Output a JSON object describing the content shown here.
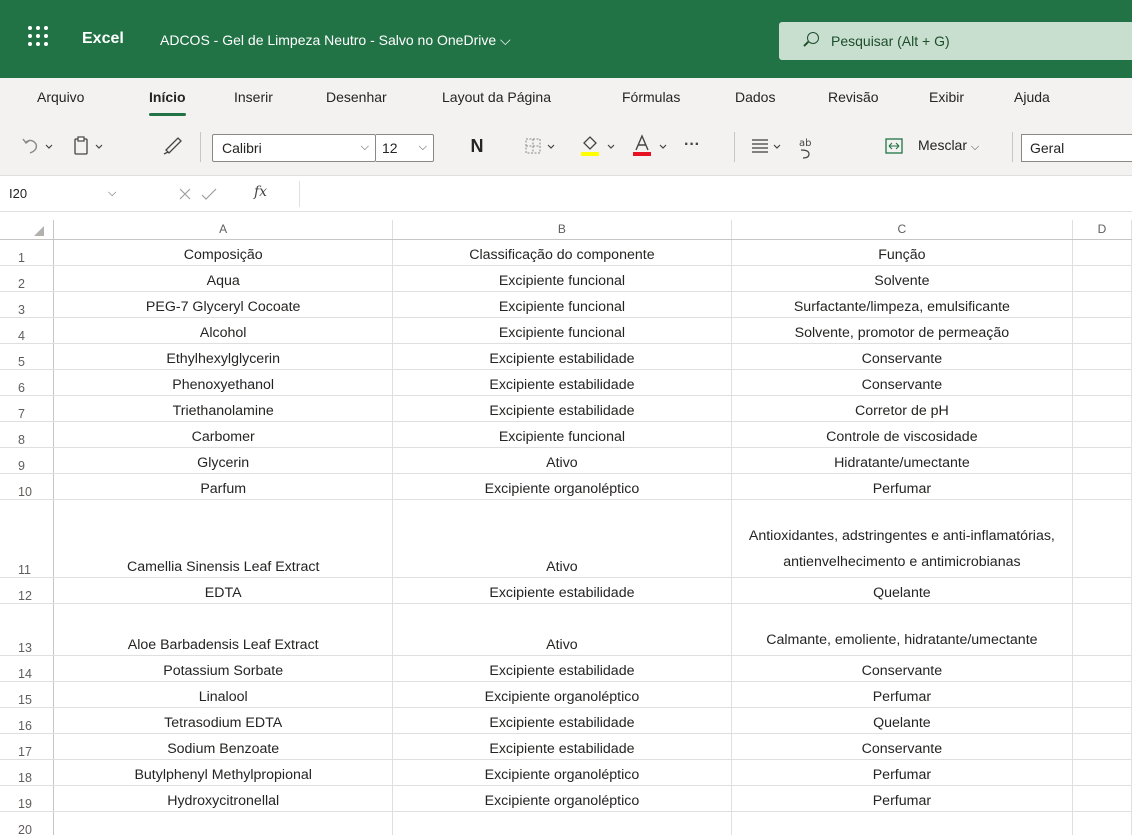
{
  "app": {
    "name": "Excel",
    "doc_title": "ADCOS - Gel de Limpeza Neutro  -  Salvo no OneDrive ⌵",
    "search_placeholder": "Pesquisar (Alt + G)",
    "accent": "#217346"
  },
  "tabs": [
    "Arquivo",
    "Início",
    "Inserir",
    "Desenhar",
    "Layout da Página",
    "Fórmulas",
    "Dados",
    "Revisão",
    "Exibir",
    "Ajuda"
  ],
  "active_tab": "Início",
  "toolbar": {
    "font": "Calibri",
    "size": "12",
    "bold_label": "N",
    "more": "···",
    "merge_label": "Mesclar",
    "number_format": "Geral",
    "undo_icon": "undo-icon",
    "paste_icon": "clipboard-icon",
    "format_painter_icon": "brush-icon",
    "borders_icon": "borders-icon",
    "fill_icon": "fill-color-icon",
    "font_color_icon": "font-color-icon",
    "align_icon": "align-icon",
    "wrap_icon": "wrap-text-icon",
    "merge_icon": "merge-icon",
    "fill_color": "#ffff00",
    "font_color": "#e81123"
  },
  "formula_bar": {
    "cell_ref": "I20",
    "fx": "fx",
    "value": ""
  },
  "grid": {
    "columns": [
      "A",
      "B",
      "C",
      "D"
    ],
    "rows": [
      {
        "n": "1",
        "a": "Composição",
        "b": "Classificação do componente",
        "c": "Função"
      },
      {
        "n": "2",
        "a": "Aqua",
        "b": "Excipiente funcional",
        "c": "Solvente"
      },
      {
        "n": "3",
        "a": "PEG-7 Glyceryl Cocoate",
        "b": "Excipiente funcional",
        "c": "Surfactante/limpeza, emulsificante"
      },
      {
        "n": "4",
        "a": "Alcohol",
        "b": "Excipiente funcional",
        "c": "Solvente, promotor de permeação"
      },
      {
        "n": "5",
        "a": "Ethylhexylglycerin",
        "b": "Excipiente estabilidade",
        "c": "Conservante"
      },
      {
        "n": "6",
        "a": "Phenoxyethanol",
        "b": "Excipiente estabilidade",
        "c": "Conservante"
      },
      {
        "n": "7",
        "a": "Triethanolamine",
        "b": "Excipiente estabilidade",
        "c": "Corretor de pH"
      },
      {
        "n": "8",
        "a": "Carbomer",
        "b": "Excipiente funcional",
        "c": "Controle de viscosidade"
      },
      {
        "n": "9",
        "a": "Glycerin",
        "b": "Ativo",
        "c": "Hidratante/umectante"
      },
      {
        "n": "10",
        "a": "Parfum",
        "b": "Excipiente organoléptico",
        "c": "Perfumar"
      },
      {
        "n": "11",
        "a": "Camellia Sinensis Leaf Extract",
        "b": "Ativo",
        "c": "Antioxidantes, adstringentes e anti-inflamatórias, antienvelhecimento e antimicrobianas"
      },
      {
        "n": "12",
        "a": "EDTA",
        "b": "Excipiente estabilidade",
        "c": "Quelante"
      },
      {
        "n": "13",
        "a": "Aloe Barbadensis Leaf Extract",
        "b": "Ativo",
        "c": "Calmante, emoliente, hidratante/umectante"
      },
      {
        "n": "14",
        "a": "Potassium Sorbate",
        "b": "Excipiente estabilidade",
        "c": "Conservante"
      },
      {
        "n": "15",
        "a": "Linalool",
        "b": "Excipiente organoléptico",
        "c": "Perfumar"
      },
      {
        "n": "16",
        "a": "Tetrasodium EDTA",
        "b": "Excipiente estabilidade",
        "c": "Quelante"
      },
      {
        "n": "17",
        "a": "Sodium Benzoate",
        "b": "Excipiente estabilidade",
        "c": "Conservante"
      },
      {
        "n": "18",
        "a": "Butylphenyl Methylpropional",
        "b": "Excipiente organoléptico",
        "c": "Perfumar"
      },
      {
        "n": "19",
        "a": "Hydroxycitronellal",
        "b": "Excipiente organoléptico",
        "c": "Perfumar"
      },
      {
        "n": "20",
        "a": "",
        "b": "",
        "c": ""
      }
    ]
  }
}
